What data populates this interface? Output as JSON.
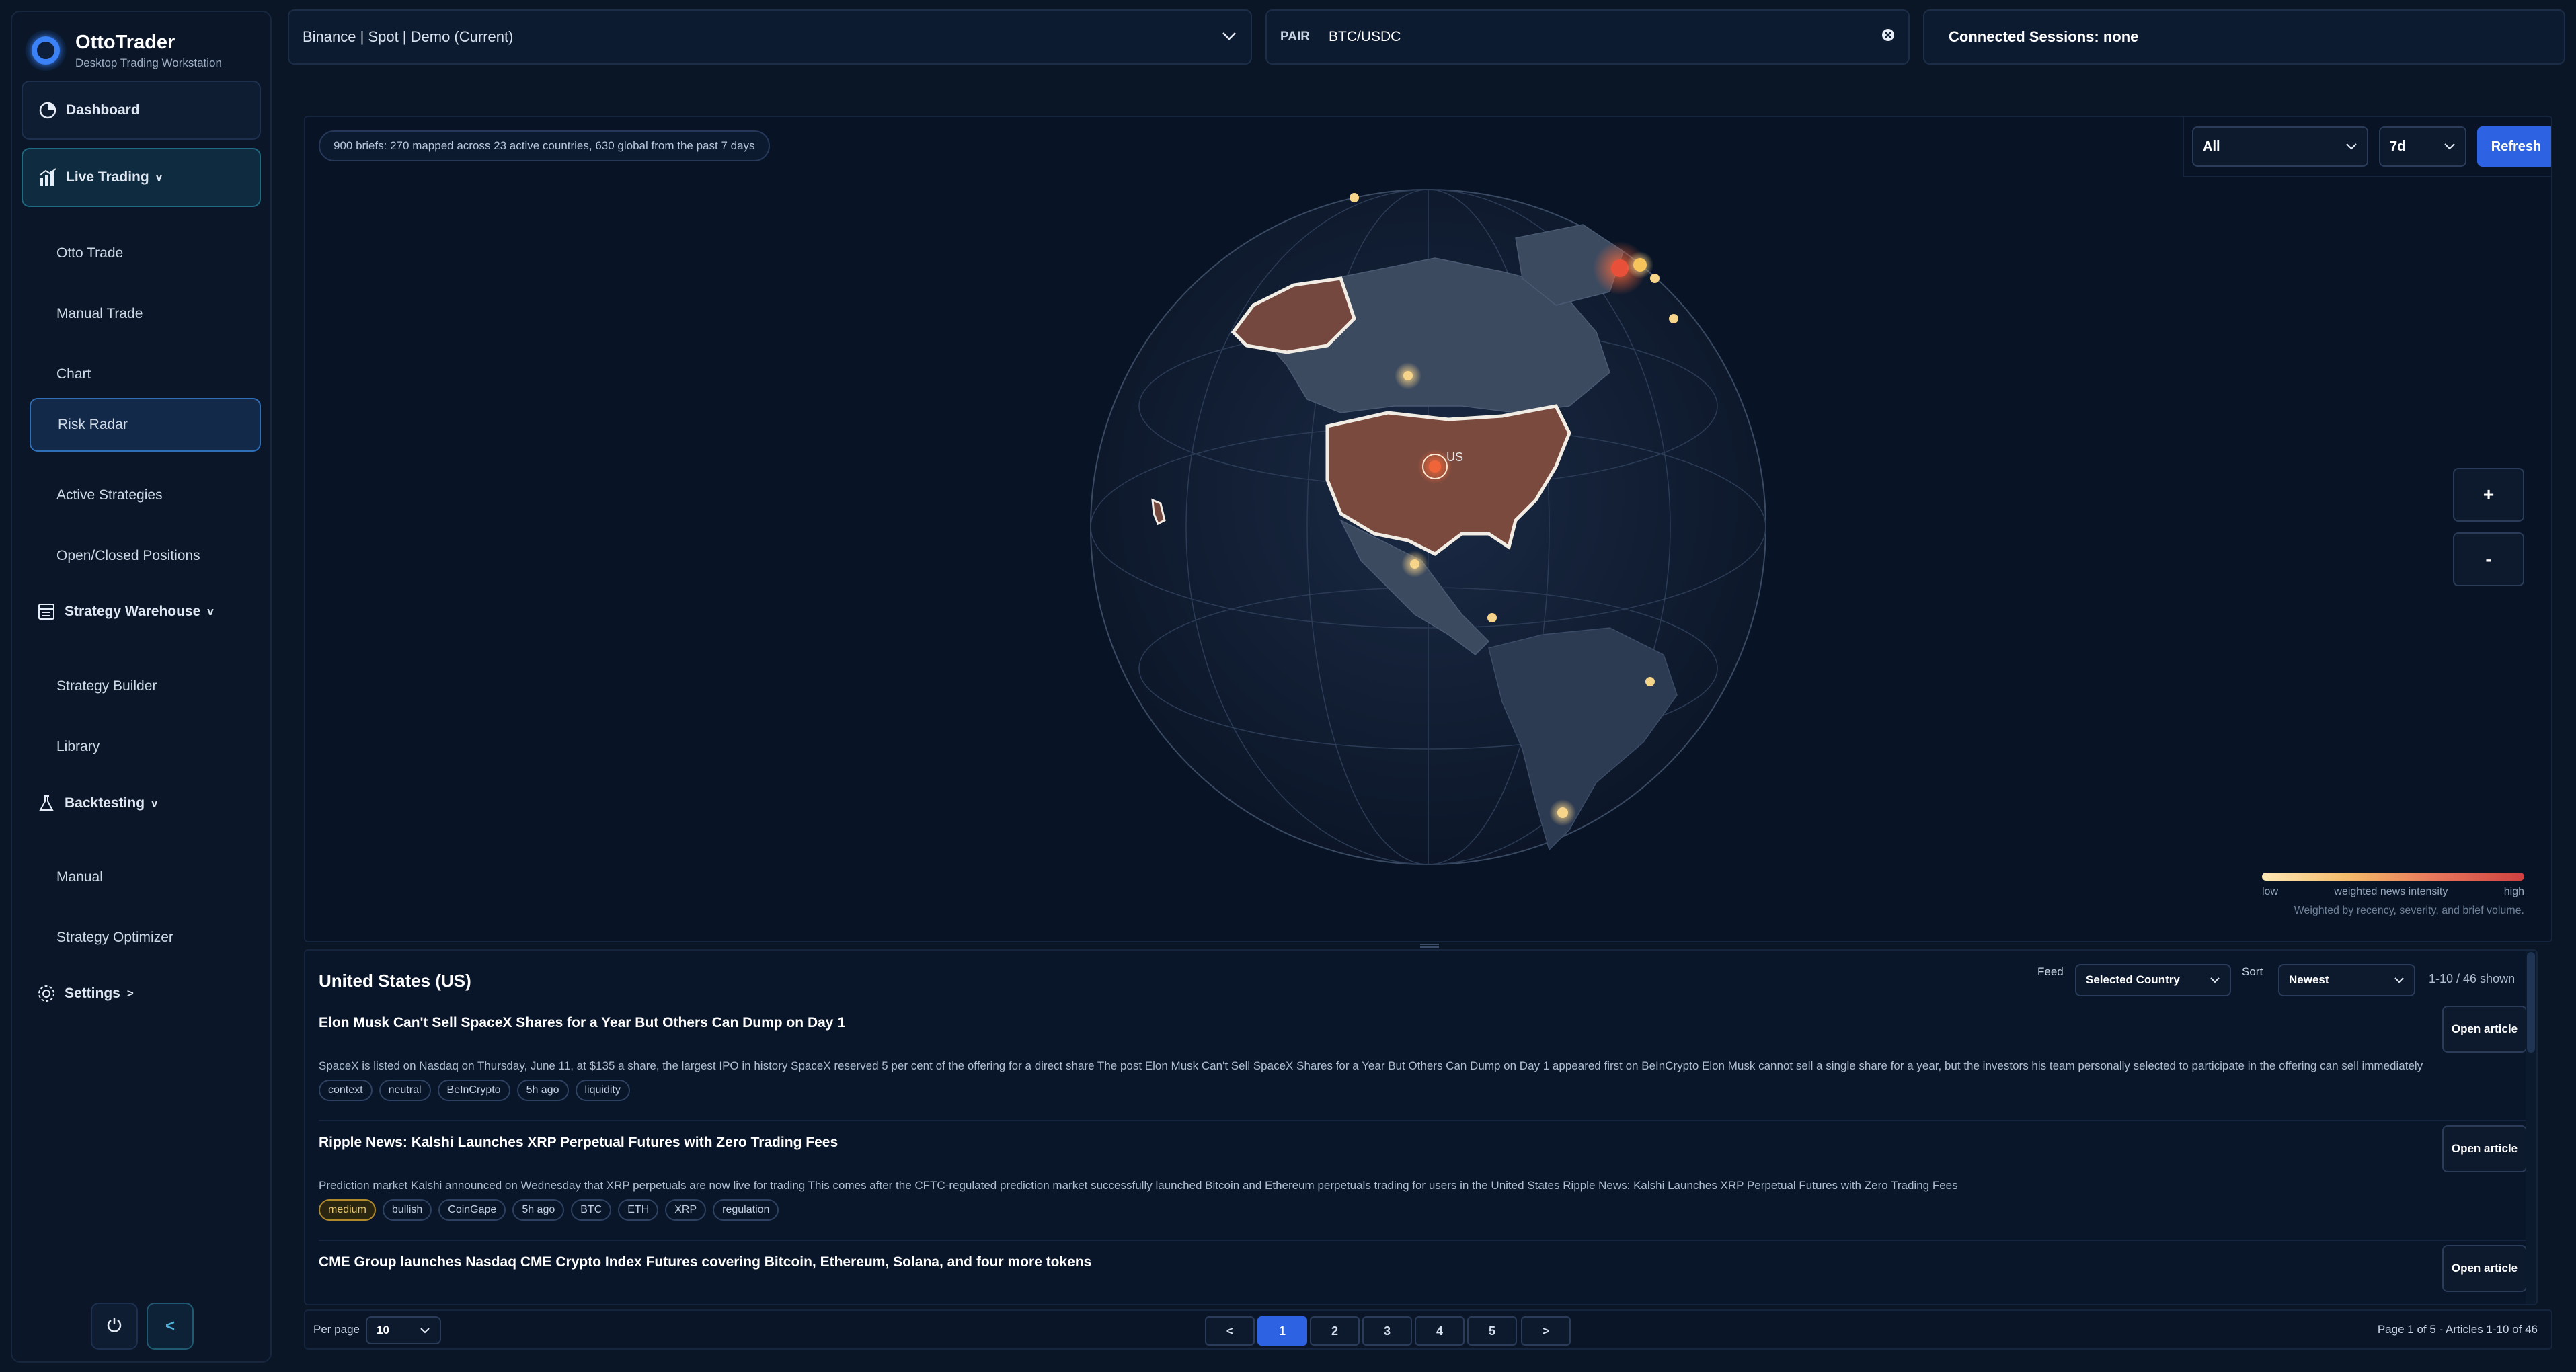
{
  "app": {
    "title": "OttoTrader",
    "subtitle": "Desktop Trading Workstation"
  },
  "sidebar": {
    "dashboard": "Dashboard",
    "live_trading": "Live Trading",
    "live_items": [
      "Otto Trade",
      "Manual Trade",
      "Chart",
      "Risk Radar",
      "Active Strategies",
      "Open/Closed Positions"
    ],
    "strategy_warehouse": "Strategy Warehouse",
    "warehouse_items": [
      "Strategy Builder",
      "Library"
    ],
    "backtesting": "Backtesting",
    "backtesting_items": [
      "Manual",
      "Strategy Optimizer"
    ],
    "settings": "Settings",
    "expand_glyph": "v",
    "settings_glyph": ">",
    "collapse_glyph": "<"
  },
  "topbar": {
    "exchange": "Binance | Spot | Demo (Current)",
    "pair_label": "PAIR",
    "pair_value": "BTC/USDC",
    "sessions": "Connected Sessions: none"
  },
  "map": {
    "brief_summary": "900 briefs: 270 mapped across 23 active countries, 630 global from the past 7 days",
    "filter_selected": "All",
    "range_selected": "7d",
    "refresh": "Refresh",
    "zoom_in": "+",
    "zoom_out": "-",
    "country_label": "US",
    "legend": {
      "low": "low",
      "mid": "weighted news intensity",
      "high": "high",
      "note": "Weighted by recency, severity, and brief volume."
    }
  },
  "news": {
    "country_title": "United States (US)",
    "feed_label": "Feed",
    "feed_value": "Selected Country",
    "sort_label": "Sort",
    "sort_value": "Newest",
    "shown": "1-10 / 46 shown",
    "open_label": "Open article",
    "articles": [
      {
        "title": "Elon Musk Can't Sell SpaceX Shares for a Year But Others Can Dump on Day 1",
        "body": "SpaceX is listed on Nasdaq on Thursday, June 11, at $135 a share, the largest IPO in history SpaceX reserved 5 per cent of the offering for a direct share The post Elon Musk Can't Sell SpaceX Shares for a Year But Others Can Dump on Day 1 appeared first on BeInCrypto Elon Musk cannot sell a single share for a year, but the investors his team personally selected to participate in the offering can sell immediately",
        "tags": [
          "context",
          "neutral",
          "BeInCrypto",
          "5h ago",
          "liquidity"
        ]
      },
      {
        "title": "Ripple News: Kalshi Launches XRP Perpetual Futures with Zero Trading Fees",
        "body": "Prediction market Kalshi announced on Wednesday that XRP perpetuals are now live for trading This comes after the CFTC-regulated prediction market successfully launched Bitcoin and Ethereum perpetuals trading for users in the United States Ripple News: Kalshi Launches XRP Perpetual Futures with Zero Trading Fees",
        "tags": [
          "medium",
          "bullish",
          "CoinGape",
          "5h ago",
          "BTC",
          "ETH",
          "XRP",
          "regulation"
        ]
      },
      {
        "title": "CME Group launches Nasdaq CME Crypto Index Futures covering Bitcoin, Ethereum, Solana, and four more tokens",
        "body": "",
        "tags": []
      }
    ]
  },
  "pager": {
    "per_page_label": "Per page",
    "per_page_value": "10",
    "prev": "<",
    "next": ">",
    "pages": [
      "1",
      "2",
      "3",
      "4",
      "5"
    ],
    "status": "Page 1 of 5 - Articles 1-10 of 46"
  },
  "colors": {
    "accent": "#2d63e2",
    "land_highlight": "#7a4a3e",
    "hot": "#e04a3a",
    "warm": "#f5c46a"
  }
}
